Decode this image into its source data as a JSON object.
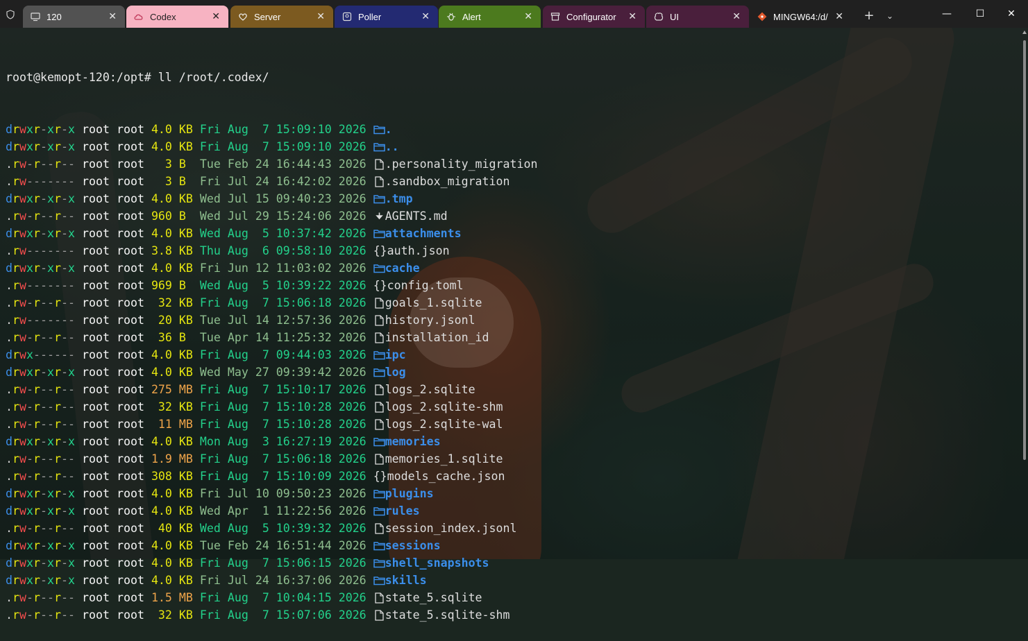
{
  "tabs": [
    {
      "label": "120",
      "icon": "monitor-icon",
      "color": "#525252",
      "active": false
    },
    {
      "label": "Codex",
      "icon": "cloud-icon",
      "color": "#f7b3c2",
      "active": true
    },
    {
      "label": "Server",
      "icon": "heart-icon",
      "color": "#7c5a20",
      "active": false
    },
    {
      "label": "Poller",
      "icon": "image-icon",
      "color": "#232a72",
      "active": false
    },
    {
      "label": "Alert",
      "icon": "bug-icon",
      "color": "#4c7a1e",
      "active": false
    },
    {
      "label": "Configurator",
      "icon": "box-icon",
      "color": "#4a1f3c",
      "active": false
    },
    {
      "label": "UI",
      "icon": "brain-icon",
      "color": "#4a1f3c",
      "active": false
    },
    {
      "label": "MINGW64:/d/",
      "icon": "git-icon",
      "color": "#202020",
      "active": false
    }
  ],
  "window_controls": {
    "new_tab": "+",
    "dropdown": "⌄",
    "minimize": "—",
    "maximize": "☐",
    "close": "✕"
  },
  "prompt": "root@kemopt-120:/opt# ll /root/.codex/",
  "entries": [
    {
      "perm": "drwxr-xr-x",
      "user": "root",
      "group": "root",
      "size": "4.0",
      "unit": "KB",
      "date": "Fri Aug  7 15:09:10 2026",
      "icon": "",
      "name": ".",
      "type": "dir"
    },
    {
      "perm": "drwxr-xr-x",
      "user": "root",
      "group": "root",
      "size": "4.0",
      "unit": "KB",
      "date": "Fri Aug  7 15:09:10 2026",
      "icon": "",
      "name": "..",
      "type": "dir"
    },
    {
      "perm": ".rw-r--r--",
      "user": "root",
      "group": "root",
      "size": "3",
      "unit": "B",
      "date": "Tue Feb 24 16:44:43 2026",
      "icon": "",
      "name": ".personality_migration",
      "type": "file"
    },
    {
      "perm": ".rw-------",
      "user": "root",
      "group": "root",
      "size": "3",
      "unit": "B",
      "date": "Fri Jul 24 16:42:02 2026",
      "icon": "",
      "name": ".sandbox_migration",
      "type": "file"
    },
    {
      "perm": "drwxr-xr-x",
      "user": "root",
      "group": "root",
      "size": "4.0",
      "unit": "KB",
      "date": "Wed Jul 15 09:40:23 2026",
      "icon": "",
      "name": ".tmp",
      "type": "dir"
    },
    {
      "perm": ".rw-r--r--",
      "user": "root",
      "group": "root",
      "size": "960",
      "unit": "B",
      "date": "Wed Jul 29 15:24:06 2026",
      "icon": "",
      "name": "AGENTS.md",
      "type": "file"
    },
    {
      "perm": "drwxr-xr-x",
      "user": "root",
      "group": "root",
      "size": "4.0",
      "unit": "KB",
      "date": "Wed Aug  5 10:37:42 2026",
      "icon": "",
      "name": "attachments",
      "type": "dir"
    },
    {
      "perm": ".rw-------",
      "user": "root",
      "group": "root",
      "size": "3.8",
      "unit": "KB",
      "date": "Thu Aug  6 09:58:10 2026",
      "icon": "{}",
      "name": "auth.json",
      "type": "file"
    },
    {
      "perm": "drwxr-xr-x",
      "user": "root",
      "group": "root",
      "size": "4.0",
      "unit": "KB",
      "date": "Fri Jun 12 11:03:02 2026",
      "icon": "",
      "name": "cache",
      "type": "dir"
    },
    {
      "perm": ".rw-------",
      "user": "root",
      "group": "root",
      "size": "969",
      "unit": "B",
      "date": "Wed Aug  5 10:39:22 2026",
      "icon": "{}",
      "name": "config.toml",
      "type": "file"
    },
    {
      "perm": ".rw-r--r--",
      "user": "root",
      "group": "root",
      "size": "32",
      "unit": "KB",
      "date": "Fri Aug  7 15:06:18 2026",
      "icon": "",
      "name": "goals_1.sqlite",
      "type": "file"
    },
    {
      "perm": ".rw-------",
      "user": "root",
      "group": "root",
      "size": "20",
      "unit": "KB",
      "date": "Tue Jul 14 12:57:36 2026",
      "icon": "",
      "name": "history.jsonl",
      "type": "file"
    },
    {
      "perm": ".rw-r--r--",
      "user": "root",
      "group": "root",
      "size": "36",
      "unit": "B",
      "date": "Tue Apr 14 11:25:32 2026",
      "icon": "",
      "name": "installation_id",
      "type": "file"
    },
    {
      "perm": "drwx------",
      "user": "root",
      "group": "root",
      "size": "4.0",
      "unit": "KB",
      "date": "Fri Aug  7 09:44:03 2026",
      "icon": "",
      "name": "ipc",
      "type": "dir"
    },
    {
      "perm": "drwxr-xr-x",
      "user": "root",
      "group": "root",
      "size": "4.0",
      "unit": "KB",
      "date": "Wed May 27 09:39:42 2026",
      "icon": "",
      "name": "log",
      "type": "dir"
    },
    {
      "perm": ".rw-r--r--",
      "user": "root",
      "group": "root",
      "size": "275",
      "unit": "MB",
      "date": "Fri Aug  7 15:10:17 2026",
      "icon": "",
      "name": "logs_2.sqlite",
      "type": "file"
    },
    {
      "perm": ".rw-r--r--",
      "user": "root",
      "group": "root",
      "size": "32",
      "unit": "KB",
      "date": "Fri Aug  7 15:10:28 2026",
      "icon": "",
      "name": "logs_2.sqlite-shm",
      "type": "file"
    },
    {
      "perm": ".rw-r--r--",
      "user": "root",
      "group": "root",
      "size": "11",
      "unit": "MB",
      "date": "Fri Aug  7 15:10:28 2026",
      "icon": "",
      "name": "logs_2.sqlite-wal",
      "type": "file"
    },
    {
      "perm": "drwxr-xr-x",
      "user": "root",
      "group": "root",
      "size": "4.0",
      "unit": "KB",
      "date": "Mon Aug  3 16:27:19 2026",
      "icon": "",
      "name": "memories",
      "type": "dir"
    },
    {
      "perm": ".rw-r--r--",
      "user": "root",
      "group": "root",
      "size": "1.9",
      "unit": "MB",
      "date": "Fri Aug  7 15:06:18 2026",
      "icon": "",
      "name": "memories_1.sqlite",
      "type": "file"
    },
    {
      "perm": ".rw-r--r--",
      "user": "root",
      "group": "root",
      "size": "308",
      "unit": "KB",
      "date": "Fri Aug  7 15:10:09 2026",
      "icon": "{}",
      "name": "models_cache.json",
      "type": "file"
    },
    {
      "perm": "drwxr-xr-x",
      "user": "root",
      "group": "root",
      "size": "4.0",
      "unit": "KB",
      "date": "Fri Jul 10 09:50:23 2026",
      "icon": "",
      "name": "plugins",
      "type": "dir"
    },
    {
      "perm": "drwxr-xr-x",
      "user": "root",
      "group": "root",
      "size": "4.0",
      "unit": "KB",
      "date": "Wed Apr  1 11:22:56 2026",
      "icon": "",
      "name": "rules",
      "type": "dir"
    },
    {
      "perm": ".rw-r--r--",
      "user": "root",
      "group": "root",
      "size": "40",
      "unit": "KB",
      "date": "Wed Aug  5 10:39:32 2026",
      "icon": "",
      "name": "session_index.jsonl",
      "type": "file"
    },
    {
      "perm": "drwxr-xr-x",
      "user": "root",
      "group": "root",
      "size": "4.0",
      "unit": "KB",
      "date": "Tue Feb 24 16:51:44 2026",
      "icon": "",
      "name": "sessions",
      "type": "dir"
    },
    {
      "perm": "drwxr-xr-x",
      "user": "root",
      "group": "root",
      "size": "4.0",
      "unit": "KB",
      "date": "Fri Aug  7 15:06:15 2026",
      "icon": "",
      "name": "shell_snapshots",
      "type": "dir"
    },
    {
      "perm": "drwxr-xr-x",
      "user": "root",
      "group": "root",
      "size": "4.0",
      "unit": "KB",
      "date": "Fri Jul 24 16:37:06 2026",
      "icon": "",
      "name": "skills",
      "type": "dir"
    },
    {
      "perm": ".rw-r--r--",
      "user": "root",
      "group": "root",
      "size": "1.5",
      "unit": "MB",
      "date": "Fri Aug  7 10:04:15 2026",
      "icon": "",
      "name": "state_5.sqlite",
      "type": "file"
    },
    {
      "perm": ".rw-r--r--",
      "user": "root",
      "group": "root",
      "size": "32",
      "unit": "KB",
      "date": "Fri Aug  7 15:07:06 2026",
      "icon": "",
      "name": "state_5.sqlite-shm",
      "type": "file"
    }
  ],
  "colors": {
    "dir": "#3b8eea",
    "read": "#e5e510",
    "write": "#f14c4c",
    "exec": "#23d18b",
    "date_recent": "#23d18b",
    "date_old": "#8fbf8f",
    "size_mb": "#f0a54a"
  }
}
